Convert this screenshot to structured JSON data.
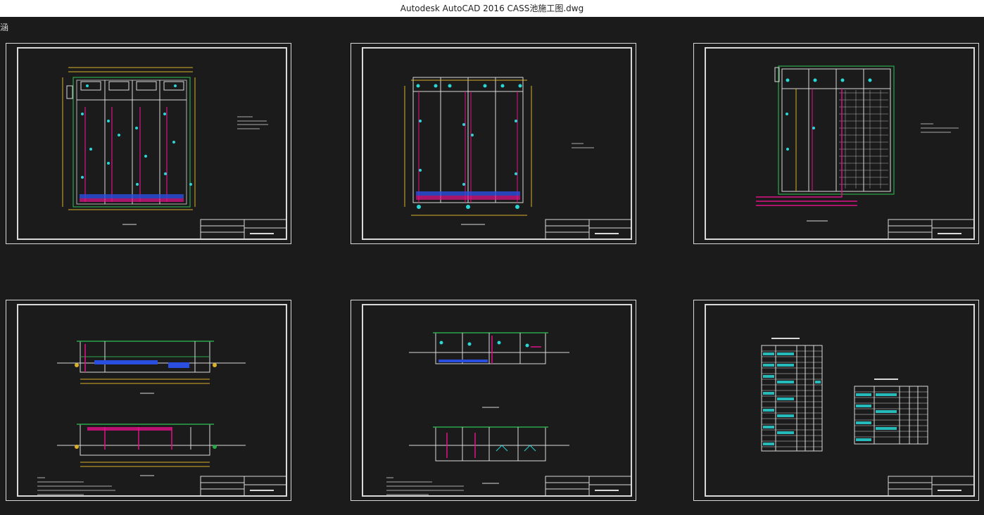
{
  "window": {
    "title": "Autodesk AutoCAD 2016     CASS池施工图.dwg"
  },
  "canvas": {
    "corner_glyph": "涵"
  },
  "colors": {
    "background": "#1b1b1b",
    "frame": "#d9d9d9",
    "green": "#2aa84a",
    "yellow": "#d9b02a",
    "magenta": "#e0128a",
    "cyan": "#2ad6d6",
    "blue": "#2a4fe0",
    "red": "#d92a2a"
  },
  "sheets": [
    {
      "name": "plan-drawing-1",
      "type": "plan-detailed"
    },
    {
      "name": "plan-drawing-2",
      "type": "plan-piping"
    },
    {
      "name": "plan-drawing-3",
      "type": "plan-aeration"
    },
    {
      "name": "section-drawing-1",
      "type": "section-pair"
    },
    {
      "name": "section-drawing-2",
      "type": "section-pair-cells"
    },
    {
      "name": "tables-drawing",
      "type": "tables"
    }
  ]
}
